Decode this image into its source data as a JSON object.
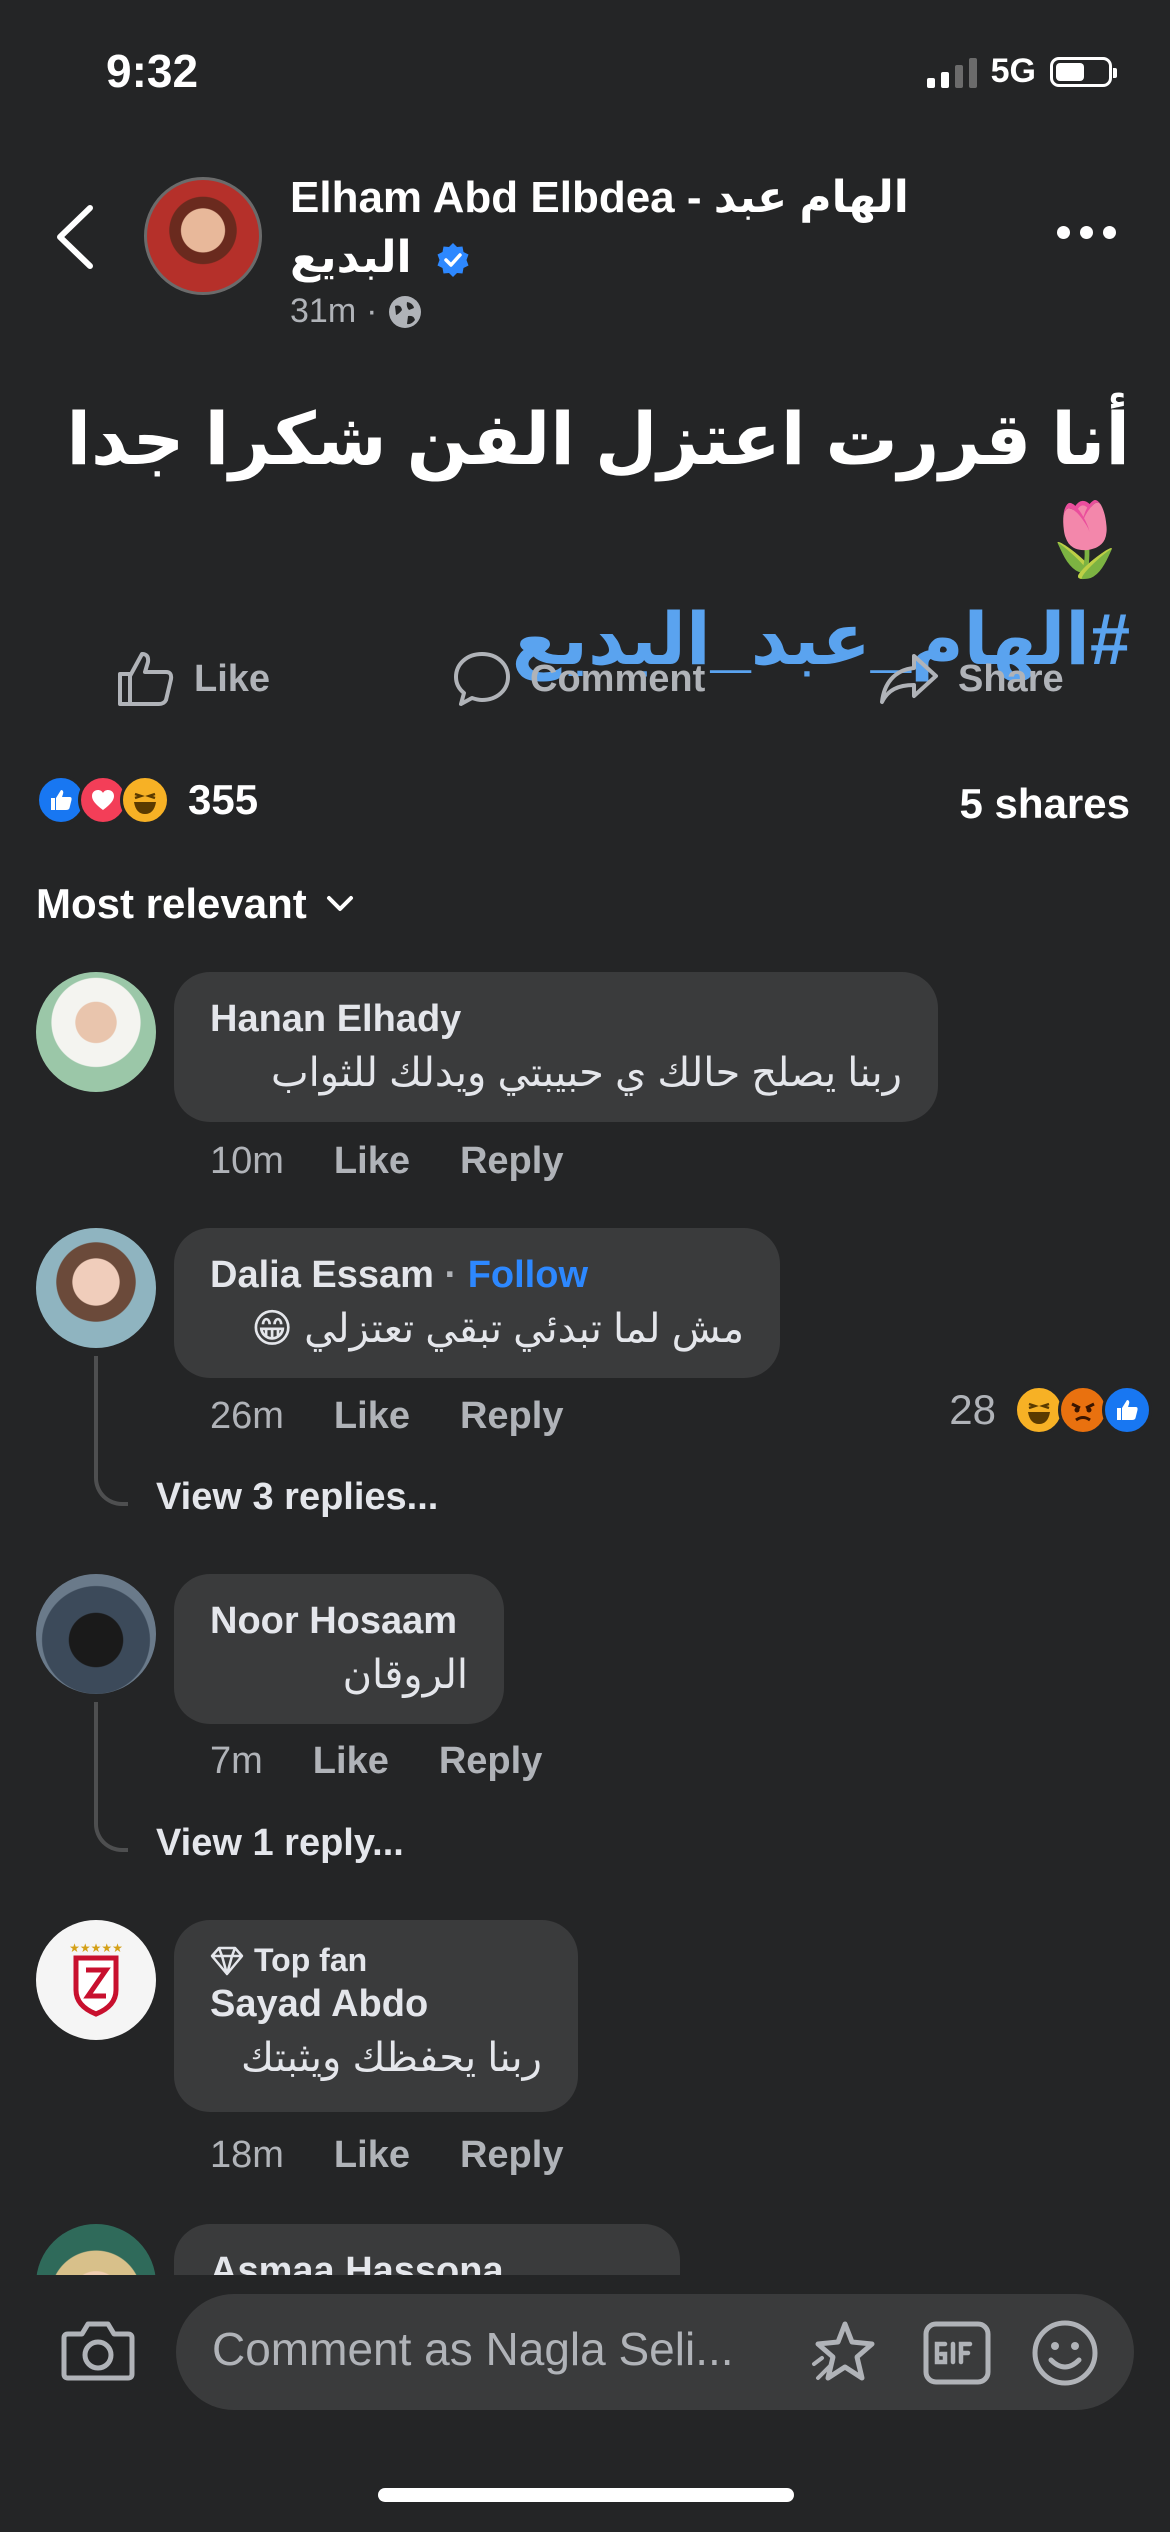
{
  "status": {
    "time": "9:32",
    "network": "5G"
  },
  "post": {
    "author": "Elham Abd Elbdea - الهام عبد البديع",
    "time": "31m",
    "separator": "·",
    "text": "أنا قررت اعتزل الفن شكرا جدا 🌷",
    "hashtag": "#الهام_عبد_البديع"
  },
  "actions": {
    "like": "Like",
    "comment": "Comment",
    "share": "Share"
  },
  "stats": {
    "reactions": "355",
    "shares": "5 shares"
  },
  "sort": {
    "label": "Most relevant"
  },
  "comments": [
    {
      "name": "Hanan Elhady",
      "text": "ربنا يصلح حالك ي حبيبتي ويدلك للثواب",
      "time": "10m",
      "like": "Like",
      "reply": "Reply"
    },
    {
      "name": "Dalia Essam",
      "follow": "Follow",
      "dot": "·",
      "text": "مش لما تبدئي تبقي تعتزلي 😁",
      "time": "26m",
      "like": "Like",
      "reply": "Reply",
      "reactions": "28",
      "view_replies": "View 3 replies..."
    },
    {
      "name": "Noor Hosaam",
      "text": "الروقان",
      "time": "7m",
      "like": "Like",
      "reply": "Reply",
      "view_replies": "View 1 reply..."
    },
    {
      "badge": "Top fan",
      "name": "Sayad Abdo",
      "text": "ربنا يحفظك ويثبتك",
      "time": "18m",
      "like": "Like",
      "reply": "Reply"
    },
    {
      "name": "Asmaa Hassona"
    }
  ],
  "composer": {
    "placeholder": "Comment as Nagla Seli..."
  },
  "colors": {
    "background": "#242526",
    "bubble": "#3a3b3c",
    "accent": "#2d88ff",
    "hashtag": "#5aa3ef"
  }
}
